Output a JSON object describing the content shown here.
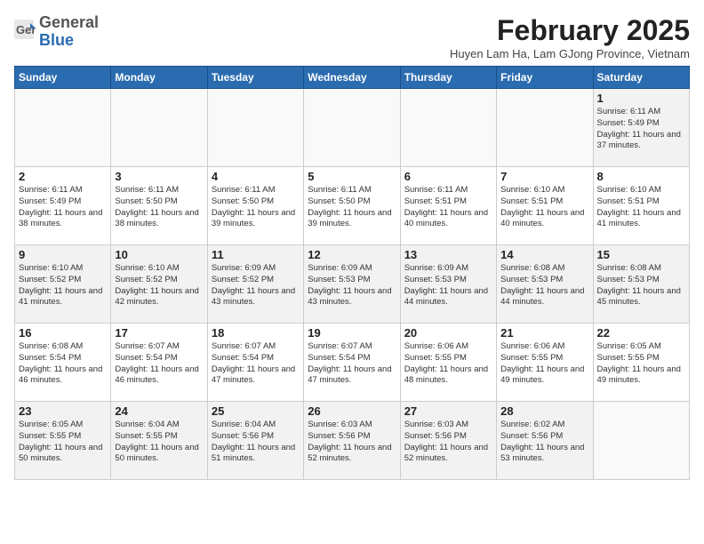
{
  "header": {
    "logo_general": "General",
    "logo_blue": "Blue",
    "month_title": "February 2025",
    "location": "Huyen Lam Ha, Lam GJong Province, Vietnam"
  },
  "weekdays": [
    "Sunday",
    "Monday",
    "Tuesday",
    "Wednesday",
    "Thursday",
    "Friday",
    "Saturday"
  ],
  "weeks": [
    [
      {
        "day": "",
        "info": ""
      },
      {
        "day": "",
        "info": ""
      },
      {
        "day": "",
        "info": ""
      },
      {
        "day": "",
        "info": ""
      },
      {
        "day": "",
        "info": ""
      },
      {
        "day": "",
        "info": ""
      },
      {
        "day": "1",
        "info": "Sunrise: 6:11 AM\nSunset: 5:49 PM\nDaylight: 11 hours\nand 37 minutes."
      }
    ],
    [
      {
        "day": "2",
        "info": "Sunrise: 6:11 AM\nSunset: 5:49 PM\nDaylight: 11 hours\nand 38 minutes."
      },
      {
        "day": "3",
        "info": "Sunrise: 6:11 AM\nSunset: 5:50 PM\nDaylight: 11 hours\nand 38 minutes."
      },
      {
        "day": "4",
        "info": "Sunrise: 6:11 AM\nSunset: 5:50 PM\nDaylight: 11 hours\nand 39 minutes."
      },
      {
        "day": "5",
        "info": "Sunrise: 6:11 AM\nSunset: 5:50 PM\nDaylight: 11 hours\nand 39 minutes."
      },
      {
        "day": "6",
        "info": "Sunrise: 6:11 AM\nSunset: 5:51 PM\nDaylight: 11 hours\nand 40 minutes."
      },
      {
        "day": "7",
        "info": "Sunrise: 6:10 AM\nSunset: 5:51 PM\nDaylight: 11 hours\nand 40 minutes."
      },
      {
        "day": "8",
        "info": "Sunrise: 6:10 AM\nSunset: 5:51 PM\nDaylight: 11 hours\nand 41 minutes."
      }
    ],
    [
      {
        "day": "9",
        "info": "Sunrise: 6:10 AM\nSunset: 5:52 PM\nDaylight: 11 hours\nand 41 minutes."
      },
      {
        "day": "10",
        "info": "Sunrise: 6:10 AM\nSunset: 5:52 PM\nDaylight: 11 hours\nand 42 minutes."
      },
      {
        "day": "11",
        "info": "Sunrise: 6:09 AM\nSunset: 5:52 PM\nDaylight: 11 hours\nand 43 minutes."
      },
      {
        "day": "12",
        "info": "Sunrise: 6:09 AM\nSunset: 5:53 PM\nDaylight: 11 hours\nand 43 minutes."
      },
      {
        "day": "13",
        "info": "Sunrise: 6:09 AM\nSunset: 5:53 PM\nDaylight: 11 hours\nand 44 minutes."
      },
      {
        "day": "14",
        "info": "Sunrise: 6:08 AM\nSunset: 5:53 PM\nDaylight: 11 hours\nand 44 minutes."
      },
      {
        "day": "15",
        "info": "Sunrise: 6:08 AM\nSunset: 5:53 PM\nDaylight: 11 hours\nand 45 minutes."
      }
    ],
    [
      {
        "day": "16",
        "info": "Sunrise: 6:08 AM\nSunset: 5:54 PM\nDaylight: 11 hours\nand 46 minutes."
      },
      {
        "day": "17",
        "info": "Sunrise: 6:07 AM\nSunset: 5:54 PM\nDaylight: 11 hours\nand 46 minutes."
      },
      {
        "day": "18",
        "info": "Sunrise: 6:07 AM\nSunset: 5:54 PM\nDaylight: 11 hours\nand 47 minutes."
      },
      {
        "day": "19",
        "info": "Sunrise: 6:07 AM\nSunset: 5:54 PM\nDaylight: 11 hours\nand 47 minutes."
      },
      {
        "day": "20",
        "info": "Sunrise: 6:06 AM\nSunset: 5:55 PM\nDaylight: 11 hours\nand 48 minutes."
      },
      {
        "day": "21",
        "info": "Sunrise: 6:06 AM\nSunset: 5:55 PM\nDaylight: 11 hours\nand 49 minutes."
      },
      {
        "day": "22",
        "info": "Sunrise: 6:05 AM\nSunset: 5:55 PM\nDaylight: 11 hours\nand 49 minutes."
      }
    ],
    [
      {
        "day": "23",
        "info": "Sunrise: 6:05 AM\nSunset: 5:55 PM\nDaylight: 11 hours\nand 50 minutes."
      },
      {
        "day": "24",
        "info": "Sunrise: 6:04 AM\nSunset: 5:55 PM\nDaylight: 11 hours\nand 50 minutes."
      },
      {
        "day": "25",
        "info": "Sunrise: 6:04 AM\nSunset: 5:56 PM\nDaylight: 11 hours\nand 51 minutes."
      },
      {
        "day": "26",
        "info": "Sunrise: 6:03 AM\nSunset: 5:56 PM\nDaylight: 11 hours\nand 52 minutes."
      },
      {
        "day": "27",
        "info": "Sunrise: 6:03 AM\nSunset: 5:56 PM\nDaylight: 11 hours\nand 52 minutes."
      },
      {
        "day": "28",
        "info": "Sunrise: 6:02 AM\nSunset: 5:56 PM\nDaylight: 11 hours\nand 53 minutes."
      },
      {
        "day": "",
        "info": ""
      }
    ]
  ]
}
